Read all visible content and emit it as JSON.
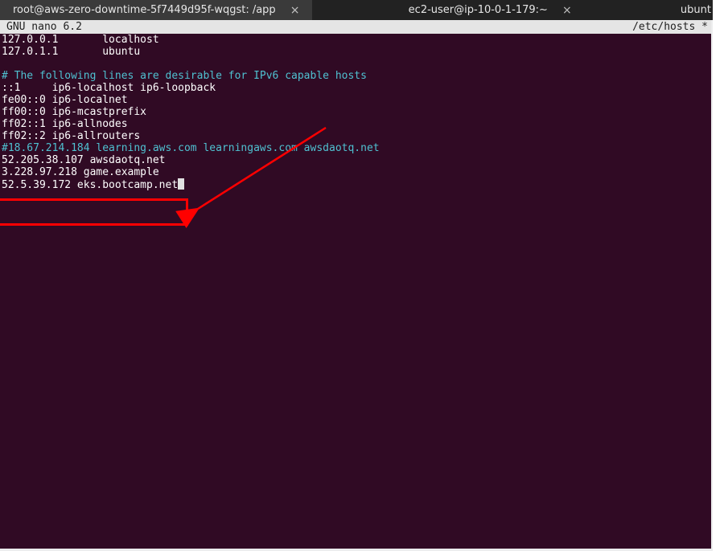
{
  "tabs": {
    "t0": {
      "title": "root@aws-zero-downtime-5f7449d95f-wqgst: /app"
    },
    "t1": {
      "title": "ec2-user@ip-10-0-1-179:~"
    },
    "t2": {
      "title": "ubunt"
    },
    "close_glyph": "×"
  },
  "nano": {
    "app": "  GNU nano 6.2",
    "file": "/etc/hosts",
    "modified": " *"
  },
  "hosts": {
    "l0": "127.0.0.1       localhost",
    "l1": "127.0.1.1       ubuntu",
    "blank1": "",
    "c0": "# The following lines are desirable for IPv6 capable hosts",
    "l2": "::1     ip6-localhost ip6-loopback",
    "l3": "fe00::0 ip6-localnet",
    "l4": "ff00::0 ip6-mcastprefix",
    "l5": "ff02::1 ip6-allnodes",
    "l6": "ff02::2 ip6-allrouters",
    "c1": "#18.67.214.184 learning.aws.com learningaws.com awsdaotq.net",
    "l7": "52.205.38.107 awsdaotq.net",
    "l8": "3.228.97.218 game.example",
    "l9": "52.5.39.172 eks.bootcamp.net"
  }
}
